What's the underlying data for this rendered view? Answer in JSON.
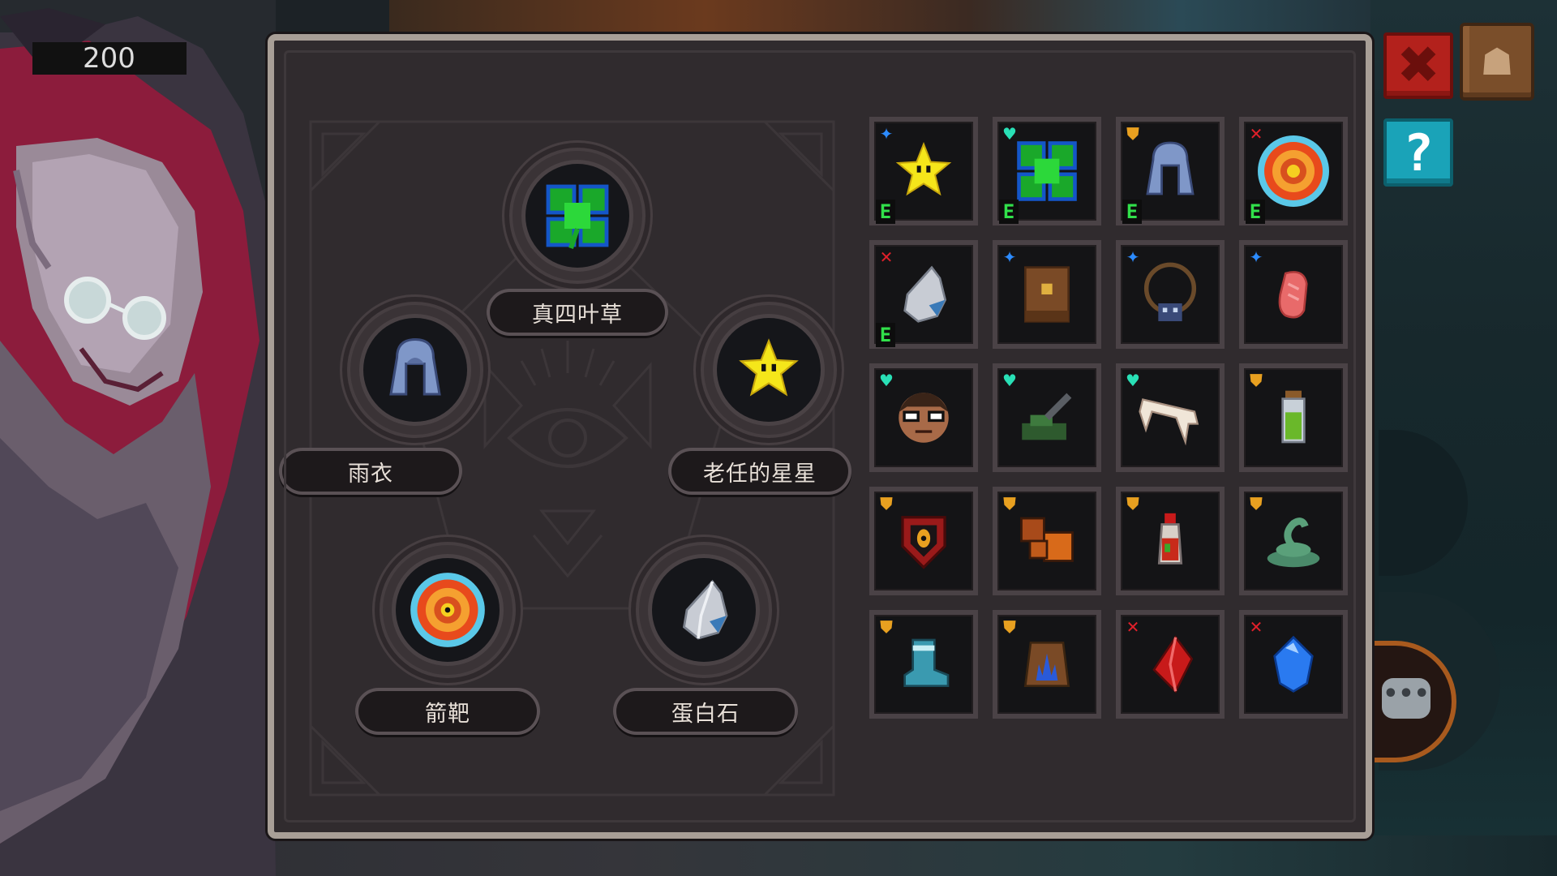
{
  "hud": {
    "score": "200"
  },
  "buttons": {
    "close_icon": "✖",
    "book_icon": "☗",
    "help_icon": "?",
    "chat_icon": "•••"
  },
  "equipped": [
    {
      "label": "真四叶草",
      "icon": "four-leaf-clover-icon"
    },
    {
      "label": "雨衣",
      "icon": "raincoat-icon"
    },
    {
      "label": "老任的星星",
      "icon": "star-icon"
    },
    {
      "label": "箭靶",
      "icon": "target-icon"
    },
    {
      "label": "蛋白石",
      "icon": "opal-icon"
    }
  ],
  "inventory": [
    {
      "icon": "star-icon",
      "badge": "star",
      "equipped": true,
      "e_label": "E"
    },
    {
      "icon": "four-leaf-clover-icon",
      "badge": "heart",
      "equipped": true,
      "e_label": "E"
    },
    {
      "icon": "raincoat-icon",
      "badge": "shield",
      "equipped": true,
      "e_label": "E"
    },
    {
      "icon": "target-icon",
      "badge": "cross",
      "equipped": true,
      "e_label": "E"
    },
    {
      "icon": "opal-icon",
      "badge": "cross",
      "equipped": true,
      "e_label": "E"
    },
    {
      "icon": "scroll-icon",
      "badge": "star",
      "equipped": false
    },
    {
      "icon": "necklace-icon",
      "badge": "star",
      "equipped": false
    },
    {
      "icon": "meat-icon",
      "badge": "star",
      "equipped": false
    },
    {
      "icon": "glasses-face-icon",
      "badge": "heart",
      "equipped": false
    },
    {
      "icon": "tank-icon",
      "badge": "heart",
      "equipped": false
    },
    {
      "icon": "bone-icon",
      "badge": "heart",
      "equipped": false
    },
    {
      "icon": "potion-green-icon",
      "badge": "shield",
      "equipped": false
    },
    {
      "icon": "shield-eye-icon",
      "badge": "shield",
      "equipped": false
    },
    {
      "icon": "bricks-icon",
      "badge": "shield",
      "equipped": false
    },
    {
      "icon": "potion-red-icon",
      "badge": "shield",
      "equipped": false
    },
    {
      "icon": "snake-icon",
      "badge": "shield",
      "equipped": false
    },
    {
      "icon": "boot-icon",
      "badge": "shield",
      "equipped": false
    },
    {
      "icon": "blue-flame-bag-icon",
      "badge": "shield",
      "equipped": false
    },
    {
      "icon": "red-crystal-icon",
      "badge": "cross",
      "equipped": false
    },
    {
      "icon": "blue-gem-icon",
      "badge": "cross",
      "equipped": false
    }
  ],
  "colors": {
    "panel_bg": "#302b2e",
    "panel_border": "#a89f97",
    "equipped_tag": "#31e04a",
    "badge_star": "#2c8bff",
    "badge_heart": "#29e0b6",
    "badge_shield": "#e8a020",
    "badge_cross": "#e0202a"
  }
}
